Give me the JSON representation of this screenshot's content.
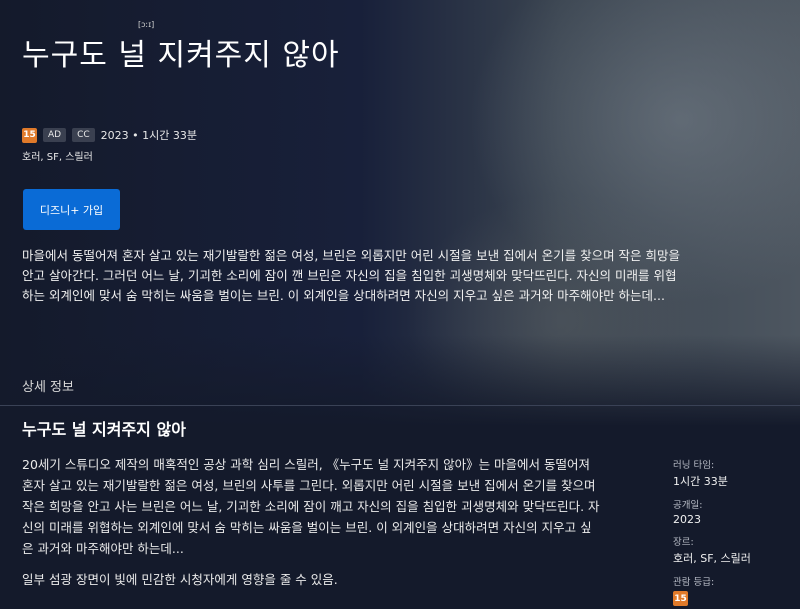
{
  "title": "누구도 널 지켜주지 않아",
  "title_mark": "[ɔːɪ]",
  "meta": {
    "rating": "15",
    "ad_chip": "AD",
    "cc_chip": "CC",
    "year_runtime": "2023 • 1시간 33분"
  },
  "genres": "호러, SF, 스릴러",
  "join_button": "디즈니+ 가입",
  "synopsis": "마을에서 동떨어져 혼자 살고 있는 재기발랄한 젊은 여성, 브린은 외롭지만 어린 시절을 보낸 집에서 온기를 찾으며 작은 희망을 안고 살아간다. 그러던 어느 날, 기괴한 소리에 잠이 깬 브린은 자신의 집을 침입한 괴생명체와 맞닥뜨린다. 자신의 미래를 위협하는 외계인에 맞서 숨 막히는 싸움을 벌이는 브린. 이 외계인을 상대하려면 자신의 지우고 싶은 과거와 마주해야만 하는데...",
  "details": {
    "section_label": "상세 정보",
    "title": "누구도 널 지켜주지 않아",
    "description": "20세기 스튜디오 제작의 매혹적인 공상 과학 심리 스릴러, 《누구도 널 지켜주지 않아》는 마을에서 동떨어져 혼자 살고 있는 재기발랄한 젊은 여성, 브린의 사투를 그린다. 외롭지만 어린 시절을 보낸 집에서 온기를 찾으며 작은 희망을 안고 사는 브린은 어느 날, 기괴한 소리에 잠이 깨고 자신의 집을 침입한 괴생명체와 맞닥뜨린다. 자신의 미래를 위협하는 외계인에 맞서 숨 막히는 싸움을 벌이는 브린. 이 외계인을 상대하려면 자신의 지우고 싶은 과거와 마주해야만 하는데...",
    "advisory": "일부 섬광 장면이 빛에 민감한 시청자에게 영향을 줄 수 있음.",
    "runtime_label": "러닝 타임:",
    "runtime_value": "1시간 33분",
    "release_label": "공개일:",
    "release_value": "2023",
    "genre_label": "장르:",
    "genre_value": "호러, SF, 스릴러",
    "rating_label": "관람 등급:",
    "rating_value": "15"
  }
}
